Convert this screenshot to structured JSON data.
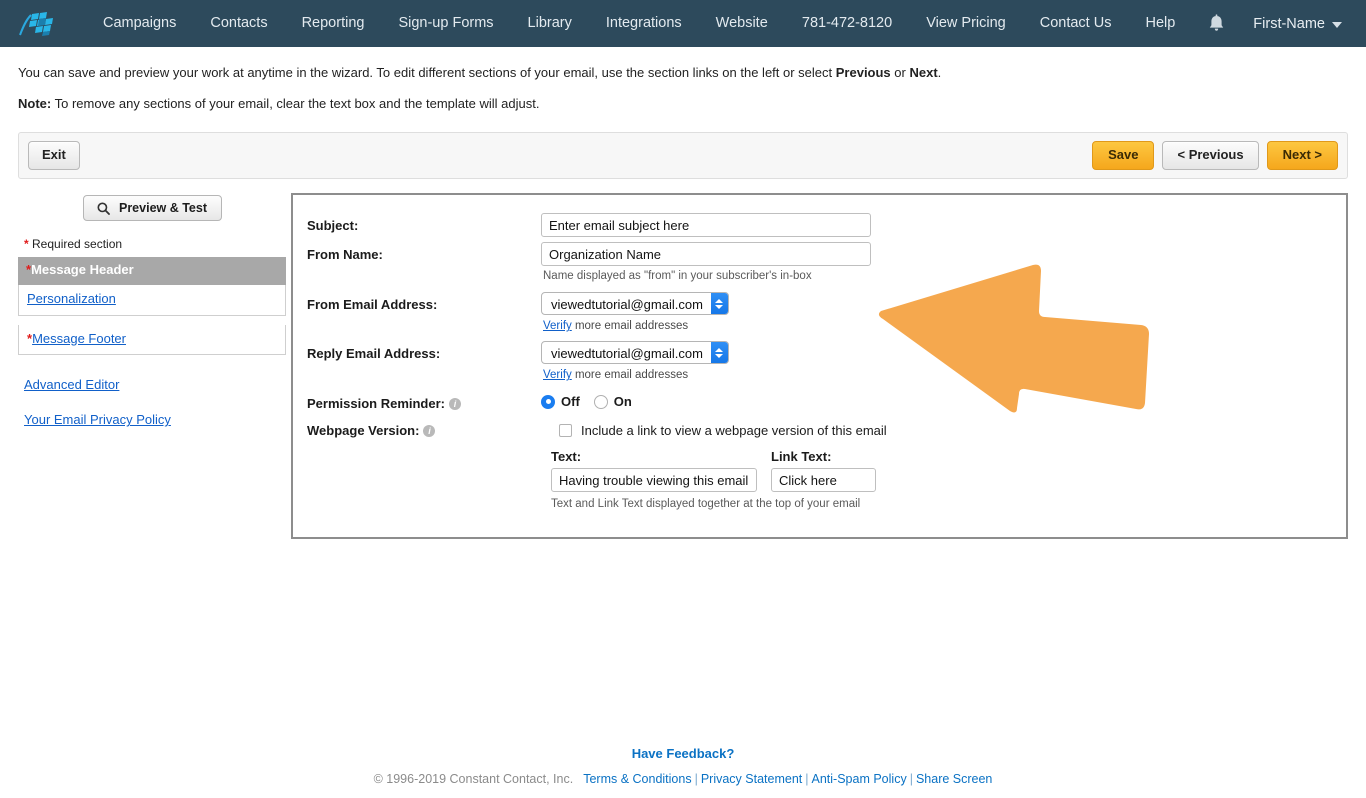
{
  "nav": {
    "logo_icon": "checkered-flag-logo",
    "items": [
      {
        "label": "Campaigns"
      },
      {
        "label": "Contacts"
      },
      {
        "label": "Reporting"
      },
      {
        "label": "Sign-up Forms"
      },
      {
        "label": "Library"
      },
      {
        "label": "Integrations"
      },
      {
        "label": "Website"
      },
      {
        "label": "781-472-8120"
      },
      {
        "label": "View Pricing"
      },
      {
        "label": "Contact Us"
      },
      {
        "label": "Help"
      }
    ],
    "bell_icon": "notification-bell-icon",
    "user_label": "First-Name",
    "caret_icon": "chevron-down-icon"
  },
  "instructions": {
    "line1_a": "You can save and preview your work at anytime in the wizard. To edit different sections of your email, use the section links on the left or select ",
    "line1_b": "Previous",
    "line1_c": " or ",
    "line1_d": "Next",
    "line1_e": ".",
    "note_label": "Note:",
    "note_text": " To remove any sections of your email, clear the text box and the template will adjust."
  },
  "toolbar": {
    "exit_label": "Exit",
    "save_label": "Save",
    "previous_label": "< Previous",
    "next_label": "Next >"
  },
  "sidebar": {
    "preview_label": "Preview & Test",
    "preview_icon": "search-icon",
    "required_star": "*",
    "required_label": " Required section",
    "sections": [
      {
        "star": "*",
        "label": "Message Header",
        "type": "header"
      },
      {
        "star": "",
        "label": "Personalization",
        "type": "link"
      },
      {
        "star": "*",
        "label": "Message Footer",
        "type": "link"
      }
    ],
    "links": [
      {
        "label": "Advanced Editor"
      },
      {
        "label": "Your Email Privacy Policy"
      }
    ]
  },
  "form": {
    "subject": {
      "label": "Subject:",
      "value": "Enter email subject here",
      "placeholder": "Enter email subject here"
    },
    "from_name": {
      "label": "From Name:",
      "value": "Organization Name",
      "placeholder": "Organization Name",
      "hint": "Name displayed as \"from\" in your subscriber's in-box"
    },
    "from_email": {
      "label": "From Email Address:",
      "value": "viewedtutorial@gmail.com",
      "verify_link": "Verify",
      "verify_rest": " more email addresses"
    },
    "reply_email": {
      "label": "Reply Email Address:",
      "value": "viewedtutorial@gmail.com",
      "verify_link": "Verify",
      "verify_rest": " more email addresses"
    },
    "permission_reminder": {
      "label": "Permission Reminder:",
      "info_icon": "info-icon",
      "options": [
        {
          "label": "Off",
          "selected": true
        },
        {
          "label": "On",
          "selected": false
        }
      ]
    },
    "webpage_version": {
      "label": "Webpage Version:",
      "info_icon": "info-icon",
      "checkbox_label": "Include a link to view a webpage version of this email",
      "checked": false,
      "text_label": "Text:",
      "text_value": "Having trouble viewing this email?",
      "link_text_label": "Link Text:",
      "link_text_value": "Click here",
      "hint": "Text and Link Text displayed together at the top of your email"
    }
  },
  "annotation": {
    "arrow_icon": "orange-arrow-left-icon",
    "arrow_color": "#f5a84e"
  },
  "footer": {
    "feedback_label": "Have Feedback?",
    "copyright": "© 1996-2019 Constant Contact, Inc.",
    "links": [
      {
        "label": "Terms & Conditions"
      },
      {
        "label": "Privacy Statement"
      },
      {
        "label": "Anti-Spam Policy"
      },
      {
        "label": "Share Screen"
      }
    ],
    "separator": "|"
  },
  "colors": {
    "nav_bg": "#2d4a5c",
    "accent_orange": "#f5a71c",
    "link_blue": "#1160c9",
    "section_header_gray": "#a8a8a8",
    "required_red": "#e01b1b"
  }
}
